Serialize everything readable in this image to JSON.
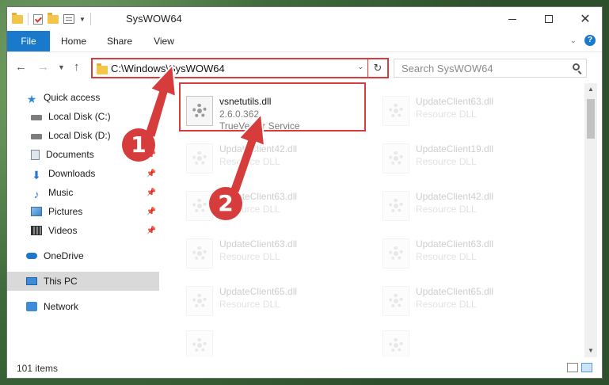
{
  "window": {
    "title": "SysWOW64"
  },
  "ribbon": {
    "tabs": [
      "File",
      "Home",
      "Share",
      "View"
    ],
    "help": "?"
  },
  "address": {
    "path": "C:\\Windows\\SysWOW64"
  },
  "search": {
    "placeholder": "Search SysWOW64"
  },
  "nav": {
    "items": [
      {
        "label": "Quick access",
        "icon": "star-icon",
        "pinned": false
      },
      {
        "label": "Local Disk (C:)",
        "icon": "drive-icon",
        "pinned": false
      },
      {
        "label": "Local Disk (D:)",
        "icon": "drive-icon",
        "pinned": false
      },
      {
        "label": "Documents",
        "icon": "documents-icon",
        "pinned": true
      },
      {
        "label": "Downloads",
        "icon": "download-icon",
        "pinned": true
      },
      {
        "label": "Music",
        "icon": "music-icon",
        "pinned": true
      },
      {
        "label": "Pictures",
        "icon": "pictures-icon",
        "pinned": true
      },
      {
        "label": "Videos",
        "icon": "videos-icon",
        "pinned": true
      },
      {
        "label": "OneDrive",
        "icon": "cloud-icon",
        "pinned": false
      },
      {
        "label": "This PC",
        "icon": "computer-icon",
        "pinned": false,
        "selected": true
      },
      {
        "label": "Network",
        "icon": "network-icon",
        "pinned": false
      }
    ]
  },
  "files": [
    {
      "name": "vsnetutils.dll",
      "line2": "2.6.0.362",
      "line3": "TrueVector Service"
    },
    {
      "name": "UpdateClient63.dll",
      "line2": "Resource DLL"
    },
    {
      "name": "UpdateClient42.dll",
      "line2": "Resource DLL"
    },
    {
      "name": "UpdateClient19.dll",
      "line2": "Resource DLL"
    },
    {
      "name": "UpdateClient63.dll",
      "line2": "Resource DLL"
    },
    {
      "name": "UpdateClient42.dll",
      "line2": "Resource DLL"
    },
    {
      "name": "UpdateClient63.dll",
      "line2": "Resource DLL"
    },
    {
      "name": "UpdateClient63.dll",
      "line2": "Resource DLL"
    },
    {
      "name": "UpdateClient65.dll",
      "line2": "Resource DLL"
    },
    {
      "name": "UpdateClient65.dll",
      "line2": "Resource DLL"
    }
  ],
  "status": {
    "items_count": "101 items"
  },
  "annotations": {
    "callout1": "1",
    "callout2": "2",
    "accent": "#d63c3c"
  }
}
